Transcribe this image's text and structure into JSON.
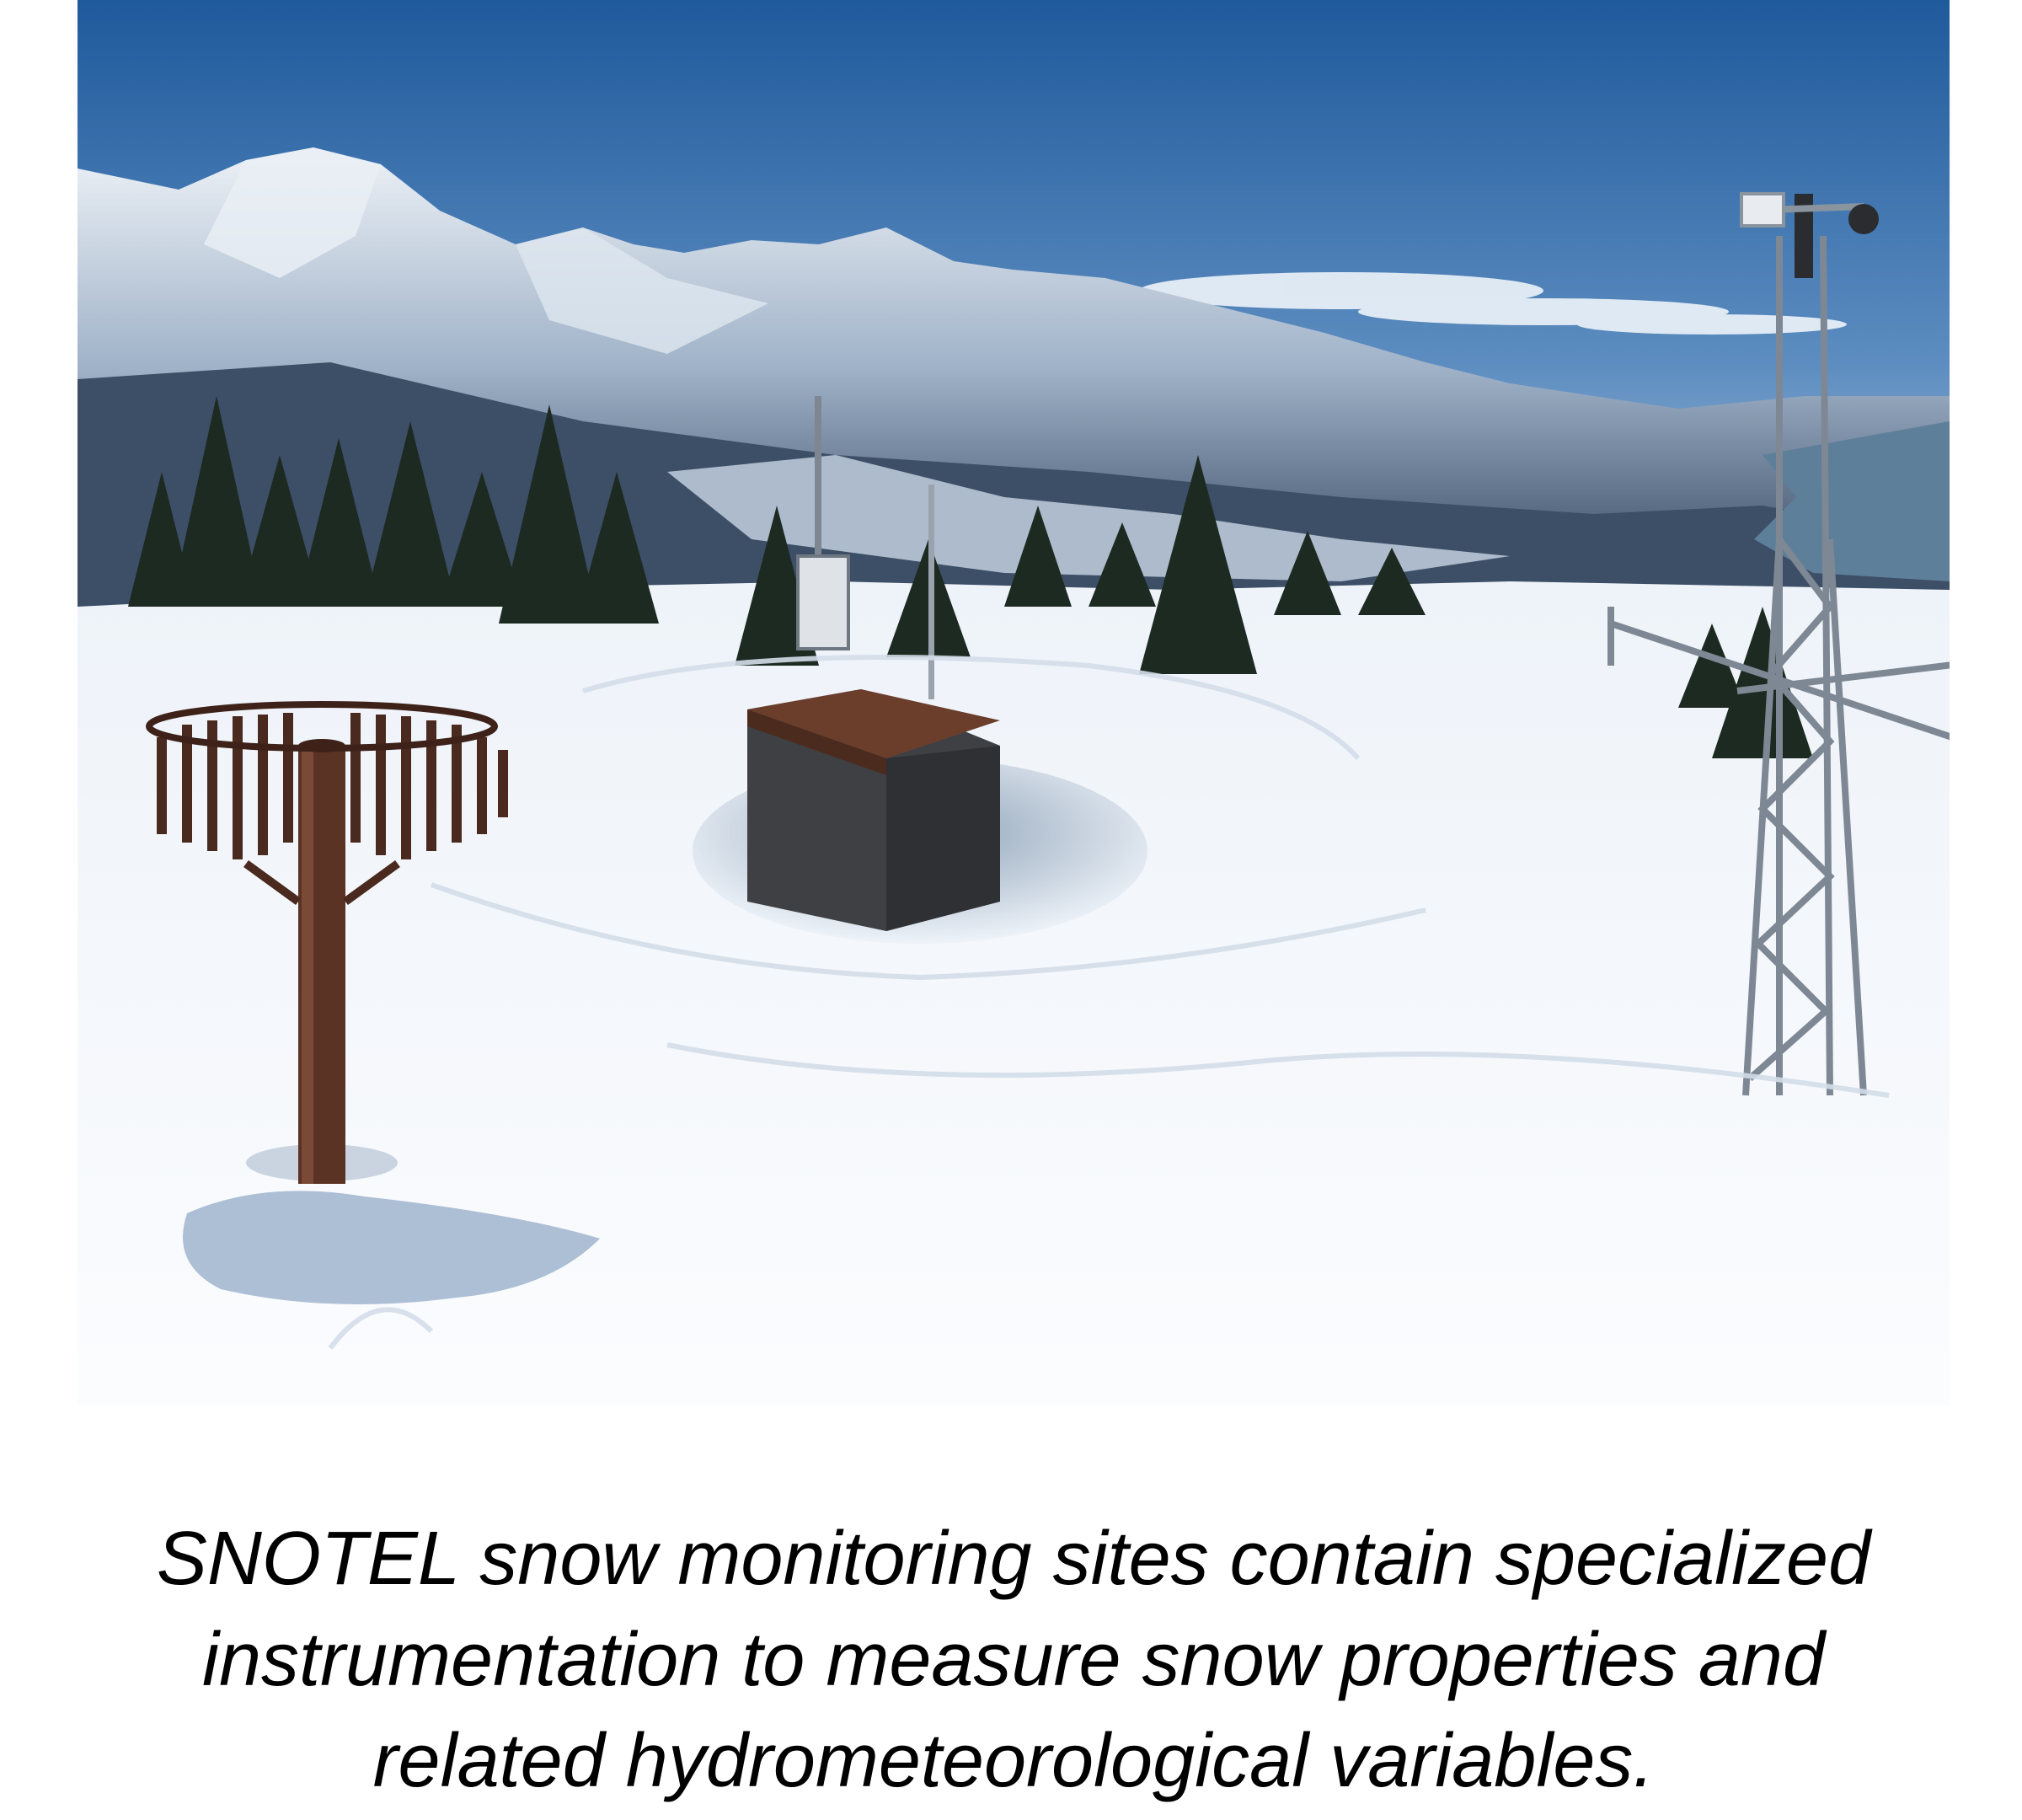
{
  "figure": {
    "caption_lines": [
      "SNOTEL snow monitoring sites contain specialized",
      "instrumentation to measure snow properties and",
      "related hydrometeorological variables."
    ]
  },
  "colors": {
    "sky_top": "#1f5a9c",
    "sky_horizon": "#a9c5de",
    "snow": "#f7f9fc",
    "snow_shadow": "#c9d6e6",
    "mountain_dark": "#2b3b52",
    "tree": "#1d2a22",
    "gauge_rust": "#5a3325",
    "shelter_roof": "#6b3e2c",
    "shelter_wall": "#3f4044",
    "water": "#5d7f99"
  }
}
